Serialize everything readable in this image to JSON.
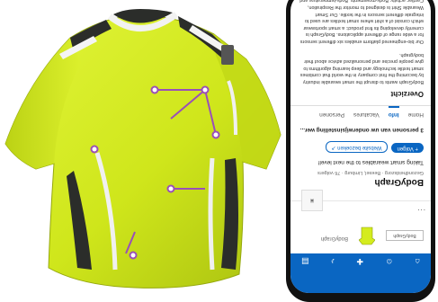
{
  "profile_page": {
    "banner": {
      "logo_text": "BodyGraph",
      "brand_small": "BodyGraph",
      "more_dots": "..."
    },
    "company": {
      "name": "BodyGraph",
      "meta": "Gezondheidszorg · Beesel, Limburg · 76 volgers",
      "tagline": "Taking smart wearables to the next level!"
    },
    "buttons": {
      "follow": "+ Volgen",
      "website": "Website bezoeken ↗"
    },
    "connections": "3 personen van uw onderwijsinstelling wer...",
    "tabs": [
      {
        "label": "Home",
        "active": false
      },
      {
        "label": "Info",
        "active": true
      },
      {
        "label": "Vacatures",
        "active": false
      },
      {
        "label": "Personen",
        "active": false
      }
    ],
    "overview": {
      "title": "Overzicht",
      "paragraphs": [
        "BodyGraph wants to disrupt the smart wearable industry by becoming the first company in the world that combines smart textile technology and deep learning algorithms to give people precise and personalized advice about their bodygraph.",
        "Our bio-engineered platform enables six different sensors for a wide range of different applications. BodyGraph is currently developing its first product: a smart sportswear which consist of a shirt where smart textiles are used to integrate different sensors in the textile. Our Smart Wearable Shirt is designed to monitor the Respiration, Cardiac activity, Body-movements, Body-temperature and Skin Conductance. Furthermore the Hydration loss is measured that empowers athletes to optimize their"
      ]
    }
  },
  "colors": {
    "brand_blue": "#0a66c2",
    "shirt_yellow": "#d4ec1e",
    "shirt_dark": "#2b2d2a",
    "sensor_purple": "#9a4fb8"
  }
}
